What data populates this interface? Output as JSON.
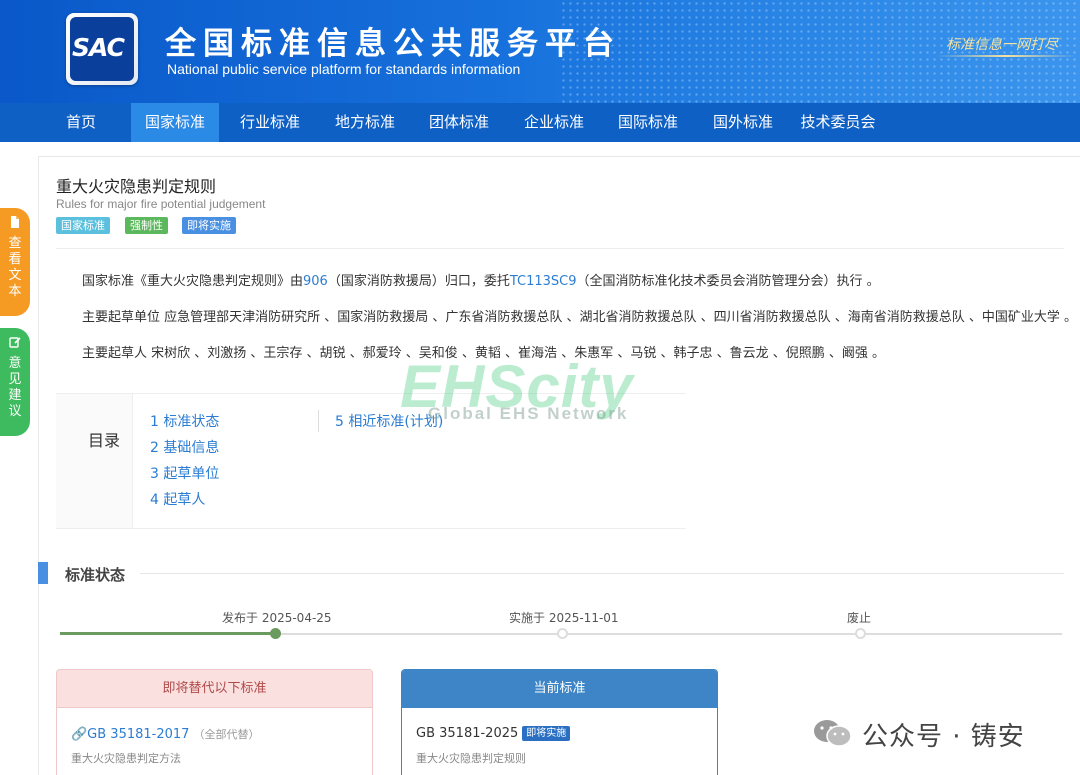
{
  "header": {
    "logo_text": "SAC",
    "title": "全国标准信息公共服务平台",
    "subtitle": "National public service platform  for standards information",
    "slogan": "标准信息一网打尽"
  },
  "nav": {
    "items": [
      {
        "label": "首页"
      },
      {
        "label": "国家标准"
      },
      {
        "label": "行业标准"
      },
      {
        "label": "地方标准"
      },
      {
        "label": "团体标准"
      },
      {
        "label": "企业标准"
      },
      {
        "label": "国际标准"
      },
      {
        "label": "国外标准"
      },
      {
        "label": "技术委员会"
      }
    ],
    "active": "国家标准"
  },
  "side_buttons": {
    "view_text": "查看文本",
    "feedback": "意见建议"
  },
  "standard": {
    "title": "重大火灾隐患判定规则",
    "en_title": "Rules for major fire potential judgement",
    "tags": [
      "国家标准",
      "强制性",
      "即将实施"
    ],
    "p1_a": "国家标准《重大火灾隐患判定规则》由",
    "p1_link1": "906",
    "p1_b": "（国家消防救援局）归口，委托",
    "p1_link2": "TC113SC9",
    "p1_c": "（全国消防标准化技术委员会消防管理分会）执行 。",
    "p2": "主要起草单位 应急管理部天津消防研究所 、国家消防救援局 、广东省消防救援总队 、湖北省消防救援总队 、四川省消防救援总队 、海南省消防救援总队 、中国矿业大学 。",
    "p3": "主要起草人 宋树欣 、刘激扬 、王宗存 、胡锐 、郝爱玲 、吴和俊 、黄韬 、崔海浩 、朱惠军 、马锐 、韩子忠 、鲁云龙 、倪照鹏 、阚强 。"
  },
  "watermark": {
    "big": "EHScity",
    "small": "Global EHS Network"
  },
  "toc": {
    "label": "目录",
    "items": [
      "1  标准状态",
      "2  基础信息",
      "3  起草单位",
      "4  起草人",
      "5  相近标准(计划)"
    ]
  },
  "status": {
    "heading": "标准状态",
    "timeline": [
      {
        "label": "发布于 2025-04-25",
        "done": true
      },
      {
        "label": "实施于 2025-11-01",
        "done": false
      },
      {
        "label": "废止",
        "done": false
      }
    ]
  },
  "replace_card": {
    "head": "即将替代以下标准",
    "code": "🔗GB 35181-2017",
    "note": "（全部代替）",
    "name": "重大火灾隐患判定方法"
  },
  "current_card": {
    "head": "当前标准",
    "code": "GB 35181-2025",
    "tag": "即将实施",
    "name": "重大火灾隐患判定规则"
  },
  "attribution": {
    "text": "公众号 · 铸安"
  }
}
